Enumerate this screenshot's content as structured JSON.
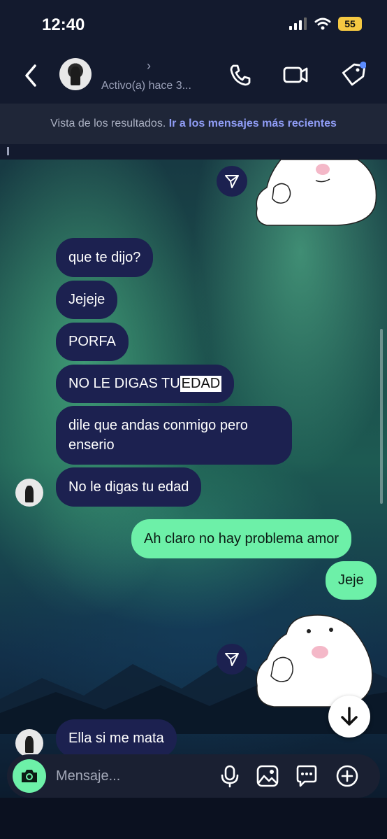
{
  "status_bar": {
    "time": "12:40",
    "battery": "55"
  },
  "header": {
    "chevron": "›",
    "presence": "Activo(a) hace 3..."
  },
  "banner": {
    "text": "Vista de los resultados. ",
    "link": "Ir a los mensajes más recientes"
  },
  "messages": {
    "m1": "que te dijo?",
    "m2": "Jejeje",
    "m3": "PORFA",
    "m4_prefix": "NO LE DIGAS TU ",
    "m4_highlight": "EDAD",
    "m5_line1": "dile que andas conmigo pero",
    "m5_line2": "enserio",
    "m6": "No le digas tu edad",
    "m7": "Ah claro no hay problema amor",
    "m8": "Jeje",
    "m9": "Ella si me mata"
  },
  "composer": {
    "placeholder": "Mensaje..."
  },
  "icons": {
    "back": "back-icon",
    "call": "phone-icon",
    "video": "video-icon",
    "tag": "tag-icon",
    "share": "send-icon",
    "scroll": "arrow-down-icon",
    "camera": "camera-icon",
    "mic": "microphone-icon",
    "gallery": "image-icon",
    "sticker": "chat-bubble-icon",
    "add": "plus-icon"
  },
  "colors": {
    "incoming": "#1c2150",
    "outgoing": "#6df0a8",
    "link": "#8f9cf5",
    "notify_dot": "#5b8cff"
  }
}
